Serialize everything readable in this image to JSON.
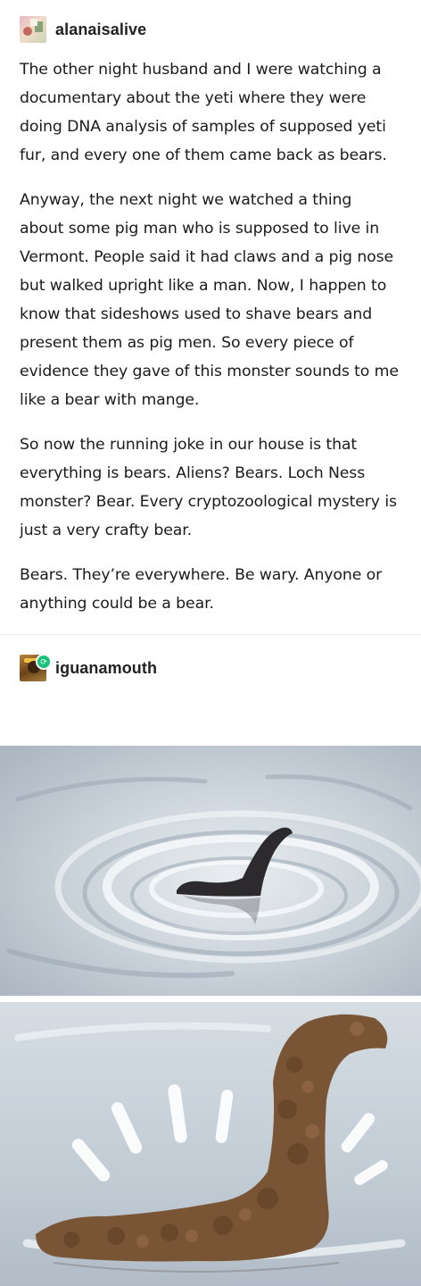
{
  "original_post": {
    "username": "alanaisalive",
    "avatar_icon": "collage-avatar",
    "paragraphs": [
      "The other night husband and I were watching a documentary about the yeti where they were doing DNA analysis of samples of supposed yeti fur, and every one of them came back as bears.",
      "Anyway, the next night we watched a thing about some pig man who is supposed to live in Vermont. People said it had claws and a pig nose but walked upright like a man. Now, I happen to know that sideshows used to shave bears and present them as pig men. So every piece of evidence they gave of this monster sounds to me like a bear with mange.",
      "So now the running joke in our house is that everything is bears. Aliens? Bears. Loch Ness monster? Bear. Every cryptozoological mystery is just a very crafty bear.",
      "Bears. They’re everywhere. Be wary. Anyone or anything could be a bear."
    ]
  },
  "reblog": {
    "username": "iguanamouth",
    "avatar_icon": "character-avatar",
    "badge_icon": "reblog-icon",
    "badge_glyph": "⟳"
  },
  "images": [
    {
      "name": "loch-ness-silhouette-painting"
    },
    {
      "name": "loch-ness-made-of-bears-painting"
    }
  ],
  "colors": {
    "text": "#1b1b1b",
    "username": "#222222",
    "badge": "#19c27b",
    "water": "#c9d3dc",
    "bear": "#7a5535"
  }
}
